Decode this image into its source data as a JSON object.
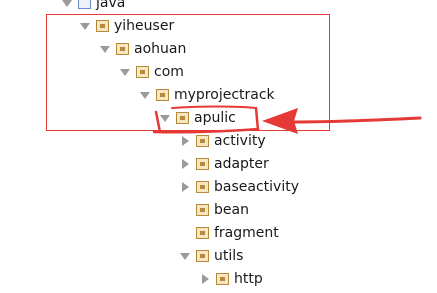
{
  "tree": {
    "items": [
      {
        "label": "java",
        "expanded": true
      },
      {
        "label": "yiheuser",
        "expanded": true
      },
      {
        "label": "aohuan",
        "expanded": true
      },
      {
        "label": "com",
        "expanded": true
      },
      {
        "label": "myprojectrack",
        "expanded": true
      },
      {
        "label": "apulic",
        "expanded": true
      },
      {
        "label": "activity",
        "expanded": false
      },
      {
        "label": "adapter",
        "expanded": false
      },
      {
        "label": "baseactivity",
        "expanded": false
      },
      {
        "label": "bean",
        "expanded": null
      },
      {
        "label": "fragment",
        "expanded": null
      },
      {
        "label": "utils",
        "expanded": true
      },
      {
        "label": "http",
        "expanded": false
      }
    ]
  },
  "colors": {
    "annotation": "#e53935",
    "package_icon": "#b58a3a",
    "toggle": "#9a9a9a",
    "text": "#1a1a1a"
  },
  "icons": {
    "folder": "source-folder-icon",
    "package": "package-icon",
    "expanded": "triangle-down-icon",
    "collapsed": "triangle-right-icon"
  }
}
